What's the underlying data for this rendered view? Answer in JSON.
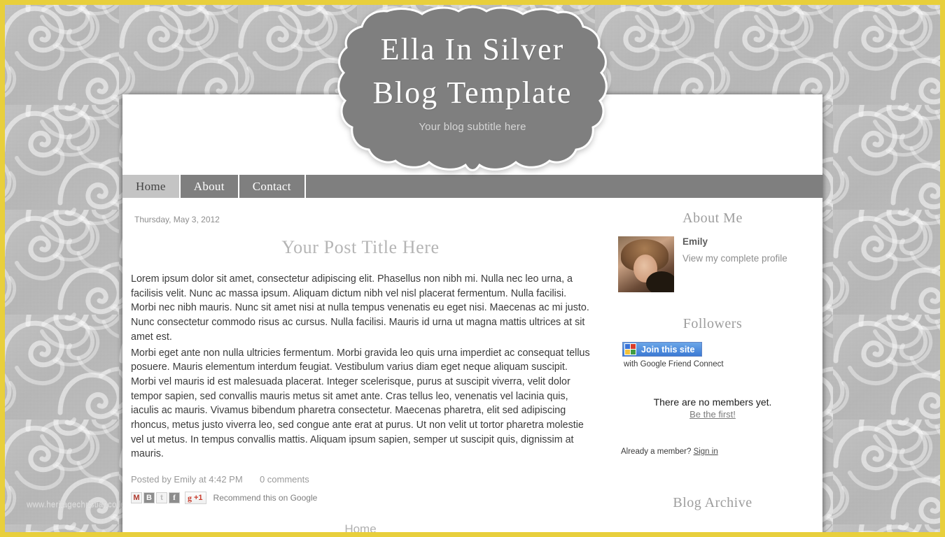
{
  "site": {
    "title_line1": "Ella In Silver",
    "title_line2": "Blog Template",
    "subtitle": "Your blog subtitle here",
    "watermark": "www.heritagechristiancollege.com",
    "accent_gold": "#e8cf3c",
    "banner_gray": "#7f7f7f",
    "nav_active_bg": "#c4c4c4"
  },
  "nav": {
    "items": [
      {
        "label": "Home",
        "active": true
      },
      {
        "label": "About",
        "active": false
      },
      {
        "label": "Contact",
        "active": false
      }
    ]
  },
  "post": {
    "date": "Thursday, May 3, 2012",
    "title": "Your Post Title Here",
    "paragraph1": "Lorem ipsum dolor sit amet, consectetur adipiscing elit. Phasellus non nibh mi. Nulla nec leo urna, a facilisis velit. Nunc ac massa ipsum. Aliquam dictum nibh vel nisl placerat fermentum. Nulla facilisi. Morbi nec nibh mauris. Nunc sit amet nisi at nulla tempus venenatis eu eget nisi. Maecenas ac mi justo. Nunc consectetur commodo risus ac cursus. Nulla facilisi. Mauris id urna ut magna mattis ultrices at sit amet est.",
    "paragraph2": "Morbi eget ante non nulla ultricies fermentum. Morbi gravida leo quis urna imperdiet ac consequat tellus posuere. Mauris elementum interdum feugiat. Vestibulum varius diam eget neque aliquam suscipit. Morbi vel mauris id est malesuada placerat. Integer scelerisque, purus at suscipit viverra, velit dolor tempor sapien, sed convallis mauris metus sit amet ante. Cras tellus leo, venenatis vel lacinia quis, iaculis ac mauris. Vivamus bibendum pharetra consectetur. Maecenas pharetra, elit sed adipiscing rhoncus, metus justo viverra leo, sed congue ante erat at purus. Ut non velit ut tortor pharetra molestie vel ut metus. In tempus convallis mattis. Aliquam ipsum sapien, semper ut suscipit quis, dignissim at mauris.",
    "posted_by": "Posted by Emily at 4:42 PM",
    "comments": "0 comments",
    "share": {
      "gmail": "M",
      "blogger": "B",
      "twitter": "t",
      "facebook": "f",
      "plusone_g": "g",
      "plusone_label": "+1",
      "recommend": "Recommend this on Google"
    },
    "bottom_home": "Home"
  },
  "sidebar": {
    "about": {
      "heading": "About Me",
      "name": "Emily",
      "profile_link": "View my complete profile"
    },
    "followers": {
      "heading": "Followers",
      "join_label": "Join this site",
      "gfc_subtitle": "with Google Friend Connect",
      "no_members": "There are no members yet.",
      "be_first": "Be the first!",
      "already_member_prefix": "Already a member?",
      "sign_in": "Sign in"
    },
    "archive": {
      "heading": "Blog Archive"
    }
  }
}
